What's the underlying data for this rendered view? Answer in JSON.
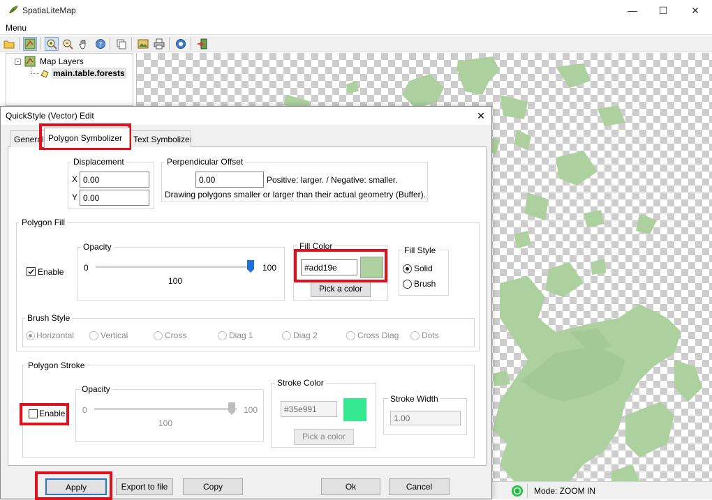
{
  "window": {
    "title": "SpatiaLiteMap",
    "menu": "Menu"
  },
  "toolbar": {
    "icons": [
      "open-icon",
      "layer-icon",
      "zoom-in-icon",
      "zoom-out-icon",
      "pan-hand-icon",
      "identify-icon",
      "copy-map-icon",
      "image-icon",
      "print-icon",
      "help-icon",
      "exit-icon"
    ]
  },
  "tree": {
    "root": "Map Layers",
    "layer": "main.table.forests"
  },
  "status": {
    "mode": "Mode: ZOOM IN"
  },
  "dialog": {
    "title": "QuickStyle (Vector) Edit",
    "tabs": [
      "General",
      "Polygon Symbolizer",
      "Text Symbolizer"
    ],
    "active_tab": "Polygon Symbolizer",
    "displacement": {
      "label": "Displacement",
      "x_label": "X",
      "x_value": "0.00",
      "y_label": "Y",
      "y_value": "0.00"
    },
    "perp_offset": {
      "label": "Perpendicular Offset",
      "value": "0.00",
      "hint1": "Positive: larger. / Negative: smaller.",
      "hint2": "Drawing polygons smaller or larger than their actual geometry (Buffer)."
    },
    "fill": {
      "label": "Polygon Fill",
      "enable_label": "Enable",
      "enabled": true,
      "opacity_label": "Opacity",
      "opacity_min": "0",
      "opacity_max": "100",
      "opacity_value": "100",
      "opacity_fraction": 1.0,
      "color_label": "Fill Color",
      "color_value": "#add19e",
      "swatch": "#add19e",
      "pick_label": "Pick a color",
      "style_label": "Fill Style",
      "style_options": [
        "Solid",
        "Brush"
      ],
      "style_selected": "Solid"
    },
    "brush": {
      "label": "Brush Style",
      "options": [
        "Horizontal",
        "Vertical",
        "Cross",
        "Diag 1",
        "Diag 2",
        "Cross Diag",
        "Dots"
      ],
      "selected": "Horizontal"
    },
    "stroke": {
      "label": "Polygon Stroke",
      "enable_label": "Enable",
      "enabled": false,
      "opacity_label": "Opacity",
      "opacity_min": "0",
      "opacity_max": "100",
      "opacity_value": "100",
      "opacity_fraction": 1.0,
      "color_label": "Stroke Color",
      "color_value": "#35e991",
      "swatch": "#35e991",
      "pick_label": "Pick a color",
      "width_label": "Stroke Width",
      "width_value": "1.00"
    },
    "buttons": {
      "apply": "Apply",
      "export": "Export to file",
      "copy": "Copy",
      "ok": "Ok",
      "cancel": "Cancel"
    }
  },
  "colors": {
    "highlight": "#e0101c",
    "map_land": "#add19e",
    "status_indicator": "#1fbf3a"
  }
}
